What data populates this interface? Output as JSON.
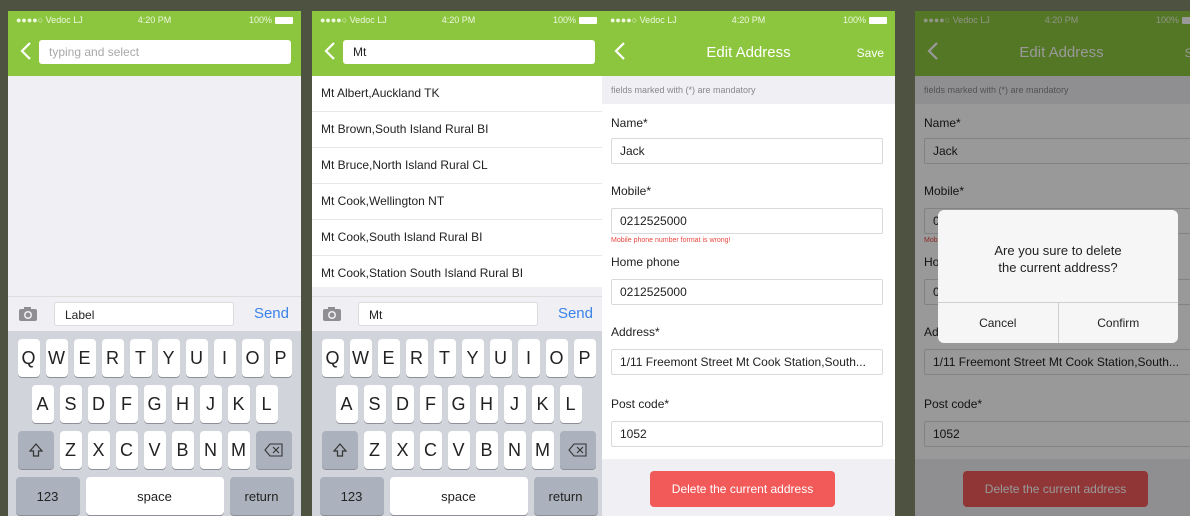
{
  "status": {
    "carrier": "●●●●○ Vedoc LJ",
    "time": "4:20 PM",
    "battery": "100%"
  },
  "screen1": {
    "search_placeholder": "typing and select",
    "input_value": "Label",
    "send": "Send"
  },
  "screen2": {
    "search_value": "Mt",
    "results": [
      "Mt Albert,Auckland TK",
      "Mt Brown,South Island Rural BI",
      "Mt Bruce,North Island Rural CL",
      "Mt Cook,Wellington NT",
      "Mt Cook,South Island Rural BI",
      "Mt Cook,Station South Island Rural BI"
    ],
    "input_value": "Mt",
    "send": "Send"
  },
  "keyboard": {
    "row1": [
      "Q",
      "W",
      "E",
      "R",
      "T",
      "Y",
      "U",
      "I",
      "O",
      "P"
    ],
    "row2": [
      "A",
      "S",
      "D",
      "F",
      "G",
      "H",
      "J",
      "K",
      "L"
    ],
    "row3": [
      "Z",
      "X",
      "C",
      "V",
      "B",
      "N",
      "M"
    ],
    "numbers": "123",
    "space": "space",
    "return": "return"
  },
  "edit": {
    "title": "Edit Address",
    "save": "Save",
    "hint": "fields marked with (*) are mandatory",
    "name_label": "Name*",
    "name_value": "Jack",
    "mobile_label": "Mobile*",
    "mobile_value": "0212525000",
    "mobile_error": "Mobile phone number format is wrong!",
    "home_label": "Home phone",
    "home_value": "0212525000",
    "address_label": "Address*",
    "address_value": "1/11 Freemont Street Mt Cook Station,South...",
    "post_label": "Post code*",
    "post_value": "1052",
    "delete_button": "Delete the current address"
  },
  "dialog": {
    "message_line1": "Are you sure to delete",
    "message_line2": "the current address?",
    "cancel": "Cancel",
    "confirm": "Confirm"
  },
  "colors": {
    "green": "#8cc63f",
    "delete_red": "#f25a5a",
    "send_blue": "#3a83e8"
  }
}
